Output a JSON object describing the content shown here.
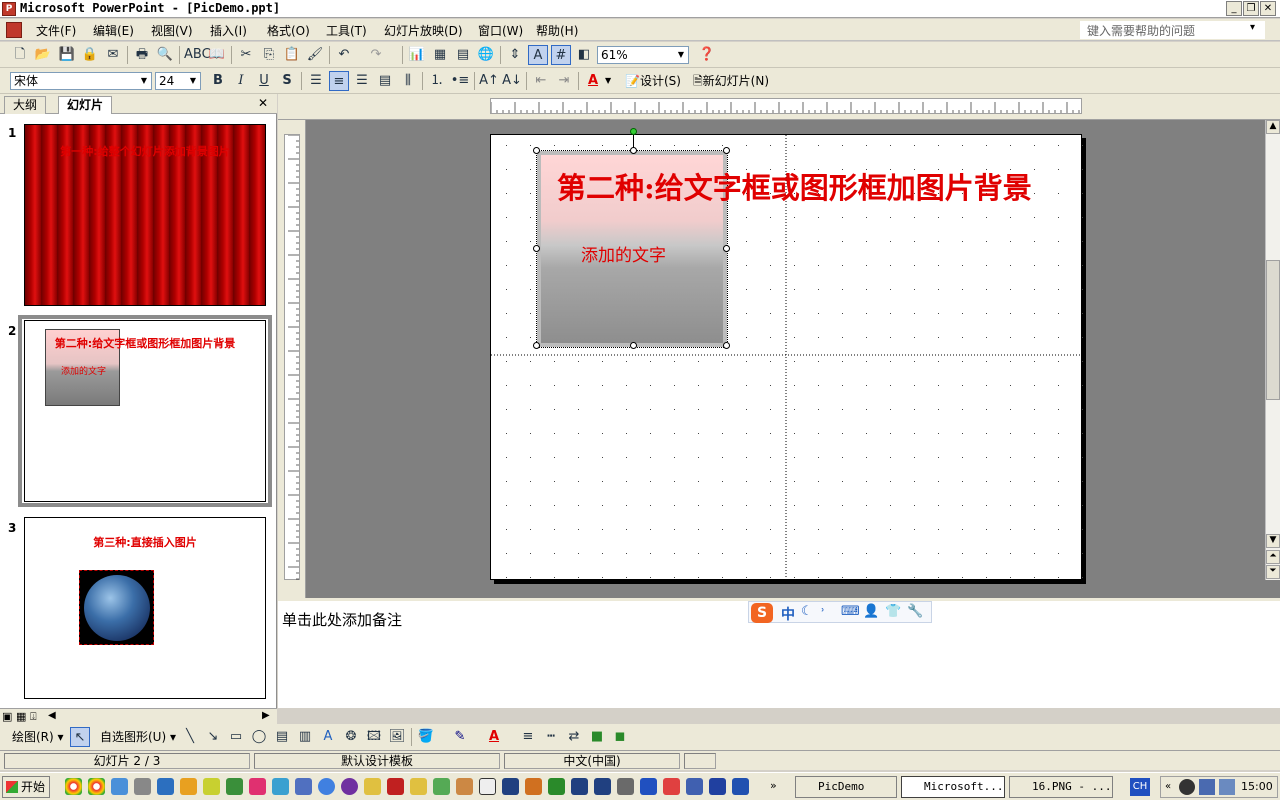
{
  "window": {
    "title": "Microsoft PowerPoint - [PicDemo.ppt]"
  },
  "menu": [
    "文件(F)",
    "编辑(E)",
    "视图(V)",
    "插入(I)",
    "格式(O)",
    "工具(T)",
    "幻灯片放映(D)",
    "窗口(W)",
    "帮助(H)"
  ],
  "help_box": "键入需要帮助的问题",
  "toolbar": {
    "zoom": "61%",
    "font": "宋体",
    "size": "24",
    "design": "设计(S)",
    "new_slide": "新幻灯片(N)"
  },
  "tabs": {
    "outline": "大纲",
    "slides": "幻灯片"
  },
  "slides": [
    {
      "num": "1",
      "title": "第一种:给整个幻灯片添加背景图片"
    },
    {
      "num": "2",
      "title": "第二种:给文字框或图形框加图片背景",
      "caption": "添加的文字"
    },
    {
      "num": "3",
      "title": "第三种:直接插入图片"
    }
  ],
  "current_slide": {
    "title": "第二种:给文字框或图形框加图片背景",
    "caption": "添加的文字"
  },
  "notes_placeholder": "单击此处添加备注",
  "drawing": {
    "draw": "绘图(R)",
    "autoshape": "自选图形(U)"
  },
  "status": {
    "slide": "幻灯片 2 / 3",
    "template": "默认设计模板",
    "language": "中文(中国)"
  },
  "taskbar": {
    "start": "开始",
    "items": [
      "PicDemo",
      "Microsoft...",
      "16.PNG - ..."
    ],
    "lang": "CH",
    "clock": "15:00"
  },
  "colors": {
    "accent_red": "#e00000",
    "highlight": "#316ac5"
  }
}
